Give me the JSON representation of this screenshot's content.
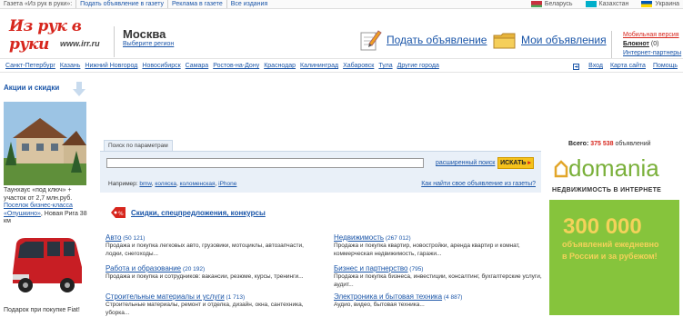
{
  "topbar": {
    "links": [
      "Газета «Из рук в руки»:",
      "Подать объявление в газету",
      "Реклама в газете",
      "Все издания"
    ],
    "countries": [
      {
        "label": "Беларусь",
        "colors": [
          "#c8313e",
          "#4aa657"
        ]
      },
      {
        "label": "Казахстан",
        "colors": [
          "#00afca",
          "#00afca"
        ]
      },
      {
        "label": "Украина",
        "colors": [
          "#0057b7",
          "#ffd700"
        ]
      }
    ]
  },
  "header": {
    "logo_text": "Из рук в руки",
    "logo_url": "www.irr.ru",
    "city": "Москва",
    "choose_region": "Выберите регион",
    "post_ad": "Подать объявление",
    "my_ads": "Мои объявления",
    "mobile_version": "Мобильная версия",
    "notebook_label": "Блокнот",
    "notebook_count": "(0)",
    "internet_partners": "Интернет-партнеры"
  },
  "citybar": {
    "cities": [
      "Санкт-Петербург",
      "Казань",
      "Нижний Новгород",
      "Новосибирск",
      "Самара",
      "Ростов-на-Дону",
      "Краснодар",
      "Калининград",
      "Хабаровск",
      "Тула",
      "Другие города"
    ],
    "login": "Вход",
    "sitemap": "Карта сайта",
    "help": "Помощь"
  },
  "left": {
    "promo_title": "Акции и скидки",
    "house_text": "Таунхаус «под ключ» + участок от 2,7 млн.руб.",
    "house_link": "Поселок бизнес-класса «Опушкино»",
    "house_suffix": ", Новая Рига 38 км",
    "van_text": "Подарок при покупке Fiat!"
  },
  "search": {
    "tab_label": "Поиск по параметрам",
    "input_value": "",
    "advanced": "расширенный поиск",
    "button": "ИСКАТЬ",
    "example_label": "Например:",
    "examples": [
      "bmw",
      "коляска",
      "коломенская",
      "iPhone"
    ],
    "how_to_find": "Как найти свое объявление из газеты?"
  },
  "discounts": {
    "label": "Скидки, спецпредложения, конкурсы"
  },
  "categories": [
    {
      "title": "Авто",
      "count": "(50 121)",
      "desc": "Продажа и покупка легковых авто, грузовики, мотоциклы, автозапчасти, лодки, снегоходы..."
    },
    {
      "title": "Недвижимость",
      "count": "(267 012)",
      "desc": "Продажа и покупка квартир, новостройки, аренда квартир и комнат, коммерческая недвижимость, гаражи..."
    },
    {
      "title": "Работа и образование",
      "count": "(20 192)",
      "desc": "Продажа и покупка и сотрудников: вакансии, резюме, курсы, тренинги..."
    },
    {
      "title": "Бизнес и партнерство",
      "count": "(795)",
      "desc": "Продажа и покупка бизнеса, инвестиции, консалтинг, бухгалтерские услуги, аудит..."
    },
    {
      "title": "Строительные материалы и услуги",
      "count": "(1 713)",
      "desc": "Строительные материалы, ремонт и отделка, дизайн, окна, сантехника, уборка..."
    },
    {
      "title": "Электроника и бытовая техника",
      "count": "(4 887)",
      "desc": "Аудио, видео, бытовая техника..."
    }
  ],
  "right": {
    "total_label": "Всего:",
    "total_number": "375 538",
    "total_suffix": "объявлений",
    "banner_brand": "domania",
    "banner_sub": "НЕДВИЖИМОСТЬ В ИНТЕРНЕТЕ",
    "banner_number": "300 000",
    "banner_line1": "объявлений ежедневно",
    "banner_line2": "в России и за рубежом!"
  }
}
